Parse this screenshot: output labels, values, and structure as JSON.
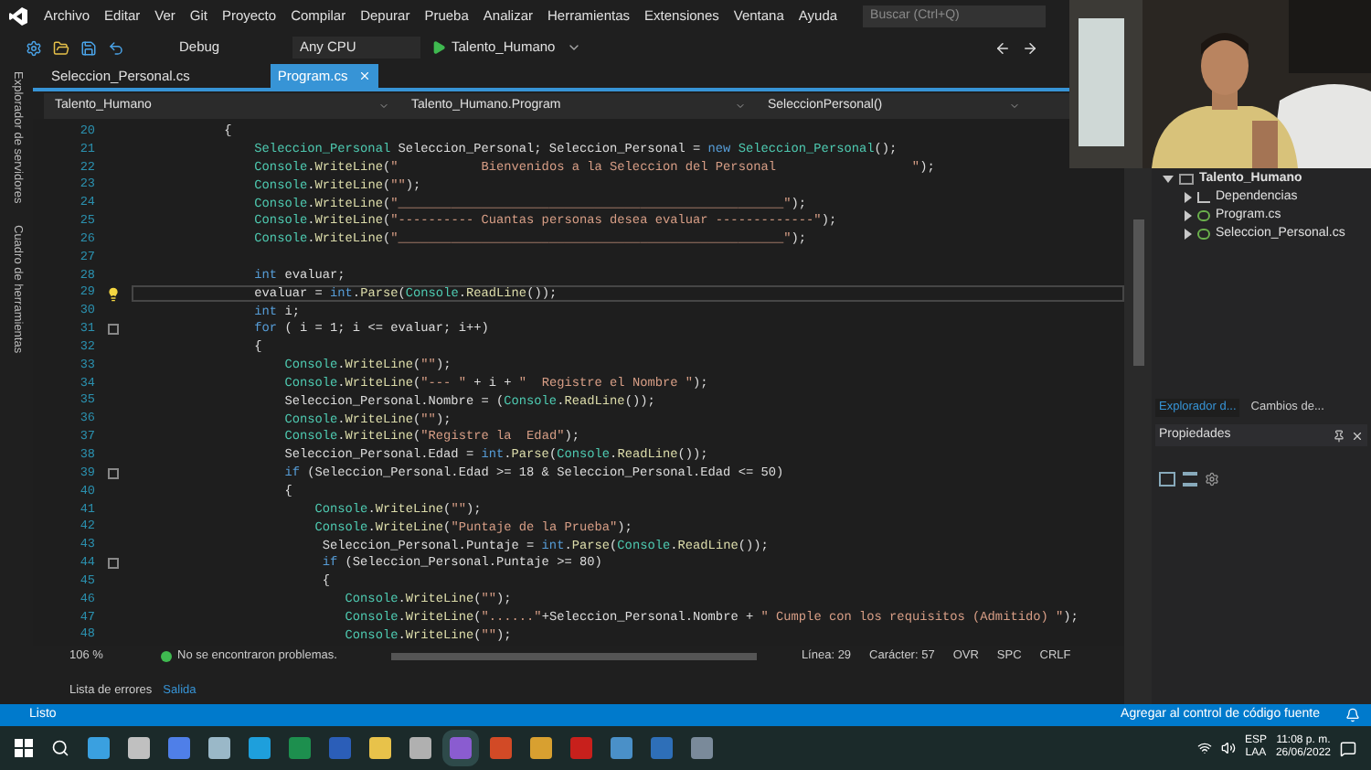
{
  "menu": [
    "Archivo",
    "Editar",
    "Ver",
    "Git",
    "Proyecto",
    "Compilar",
    "Depurar",
    "Prueba",
    "Analizar",
    "Herramientas",
    "Extensiones",
    "Ventana",
    "Ayuda"
  ],
  "search": {
    "placeholder": "Buscar (Ctrl+Q)"
  },
  "toolbar": {
    "configuration": "Debug",
    "platform": "Any CPU",
    "start_project": "Talento_Humano"
  },
  "side_tabs": [
    "Explorador de servidores",
    "Cuadro de herramientas"
  ],
  "doc_tabs": [
    {
      "label": "Seleccion_Personal.cs",
      "selected": false
    },
    {
      "label": "Program.cs",
      "selected": true
    }
  ],
  "nav_bar": [
    "Talento_Humano",
    "Talento_Humano.Program",
    "SeleccionPersonal()"
  ],
  "code_lines": [
    {
      "number": "20",
      "current": false,
      "tokens": [
        {
          "kind": "p",
          "text": "            {"
        }
      ]
    },
    {
      "number": "21",
      "current": false,
      "tokens": [
        {
          "kind": "type",
          "text": "                Seleccion_Personal"
        },
        {
          "kind": "p",
          "text": " Seleccion_Personal; Seleccion_Personal = "
        },
        {
          "kind": "kw",
          "text": "new"
        },
        {
          "kind": "type",
          "text": " Seleccion_Personal"
        },
        {
          "kind": "p",
          "text": "();"
        }
      ]
    },
    {
      "number": "22",
      "current": false,
      "tokens": [
        {
          "kind": "type",
          "text": "                Console"
        },
        {
          "kind": "p",
          "text": "."
        },
        {
          "kind": "fn",
          "text": "WriteLine"
        },
        {
          "kind": "p",
          "text": "("
        },
        {
          "kind": "str",
          "text": "\"           Bienvenidos a la Seleccion del Personal                  \""
        },
        {
          "kind": "p",
          "text": ");"
        }
      ]
    },
    {
      "number": "23",
      "current": false,
      "tokens": [
        {
          "kind": "type",
          "text": "                Console"
        },
        {
          "kind": "p",
          "text": "."
        },
        {
          "kind": "fn",
          "text": "WriteLine"
        },
        {
          "kind": "p",
          "text": "("
        },
        {
          "kind": "str",
          "text": "\"\""
        },
        {
          "kind": "p",
          "text": ");"
        }
      ]
    },
    {
      "number": "24",
      "current": false,
      "tokens": [
        {
          "kind": "type",
          "text": "                Console"
        },
        {
          "kind": "p",
          "text": "."
        },
        {
          "kind": "fn",
          "text": "WriteLine"
        },
        {
          "kind": "p",
          "text": "("
        },
        {
          "kind": "str",
          "text": "\"___________________________________________________\""
        },
        {
          "kind": "p",
          "text": ");"
        }
      ]
    },
    {
      "number": "25",
      "current": false,
      "tokens": [
        {
          "kind": "type",
          "text": "                Console"
        },
        {
          "kind": "p",
          "text": "."
        },
        {
          "kind": "fn",
          "text": "WriteLine"
        },
        {
          "kind": "p",
          "text": "("
        },
        {
          "kind": "str",
          "text": "\"---------- Cuantas personas desea evaluar -------------\""
        },
        {
          "kind": "p",
          "text": ");"
        }
      ]
    },
    {
      "number": "26",
      "current": false,
      "tokens": [
        {
          "kind": "type",
          "text": "                Console"
        },
        {
          "kind": "p",
          "text": "."
        },
        {
          "kind": "fn",
          "text": "WriteLine"
        },
        {
          "kind": "p",
          "text": "("
        },
        {
          "kind": "str",
          "text": "\"___________________________________________________\""
        },
        {
          "kind": "p",
          "text": ");"
        }
      ]
    },
    {
      "number": "27",
      "current": false
    },
    {
      "number": "28",
      "current": false,
      "tokens": [
        {
          "kind": "kw",
          "text": "                int"
        },
        {
          "kind": "p",
          "text": " evaluar;"
        }
      ]
    },
    {
      "number": "29",
      "current": true,
      "kind": "bulb",
      "tokens": [
        {
          "kind": "p",
          "text": "                evaluar = "
        },
        {
          "kind": "kw",
          "text": "int"
        },
        {
          "kind": "p",
          "text": "."
        },
        {
          "kind": "fn",
          "text": "Parse"
        },
        {
          "kind": "p",
          "text": "("
        },
        {
          "kind": "type",
          "text": "Console"
        },
        {
          "kind": "p",
          "text": "."
        },
        {
          "kind": "fn",
          "text": "ReadLine"
        },
        {
          "kind": "p",
          "text": "());"
        }
      ]
    },
    {
      "number": "30",
      "current": false,
      "tokens": [
        {
          "kind": "kw",
          "text": "                int"
        },
        {
          "kind": "p",
          "text": " i;"
        }
      ]
    },
    {
      "number": "31",
      "current": false,
      "kind": "fold",
      "tokens": [
        {
          "kind": "kw",
          "text": "                for"
        },
        {
          "kind": "p",
          "text": " ( i = 1; i <= evaluar; i++)"
        }
      ]
    },
    {
      "number": "32",
      "current": false,
      "tokens": [
        {
          "kind": "p",
          "text": "                {"
        }
      ]
    },
    {
      "number": "33",
      "current": false,
      "tokens": [
        {
          "kind": "type",
          "text": "                    Console"
        },
        {
          "kind": "p",
          "text": "."
        },
        {
          "kind": "fn",
          "text": "WriteLine"
        },
        {
          "kind": "p",
          "text": "("
        },
        {
          "kind": "str",
          "text": "\"\""
        },
        {
          "kind": "p",
          "text": ");"
        }
      ]
    },
    {
      "number": "34",
      "current": false,
      "tokens": [
        {
          "kind": "type",
          "text": "                    Console"
        },
        {
          "kind": "p",
          "text": "."
        },
        {
          "kind": "fn",
          "text": "WriteLine"
        },
        {
          "kind": "p",
          "text": "("
        },
        {
          "kind": "str",
          "text": "\"--- \""
        },
        {
          "kind": "p",
          "text": " + i + "
        },
        {
          "kind": "str",
          "text": "\"  Registre el Nombre \""
        },
        {
          "kind": "p",
          "text": ");"
        }
      ]
    },
    {
      "number": "35",
      "current": false,
      "tokens": [
        {
          "kind": "p",
          "text": "                    Seleccion_Personal.Nombre = ("
        },
        {
          "kind": "type",
          "text": "Console"
        },
        {
          "kind": "p",
          "text": "."
        },
        {
          "kind": "fn",
          "text": "ReadLine"
        },
        {
          "kind": "p",
          "text": "());"
        }
      ]
    },
    {
      "number": "36",
      "current": false,
      "tokens": [
        {
          "kind": "type",
          "text": "                    Console"
        },
        {
          "kind": "p",
          "text": "."
        },
        {
          "kind": "fn",
          "text": "WriteLine"
        },
        {
          "kind": "p",
          "text": "("
        },
        {
          "kind": "str",
          "text": "\"\""
        },
        {
          "kind": "p",
          "text": ");"
        }
      ]
    },
    {
      "number": "37",
      "current": false,
      "tokens": [
        {
          "kind": "type",
          "text": "                    Console"
        },
        {
          "kind": "p",
          "text": "."
        },
        {
          "kind": "fn",
          "text": "WriteLine"
        },
        {
          "kind": "p",
          "text": "("
        },
        {
          "kind": "str",
          "text": "\"Registre la  Edad\""
        },
        {
          "kind": "p",
          "text": ");"
        }
      ]
    },
    {
      "number": "38",
      "current": false,
      "tokens": [
        {
          "kind": "p",
          "text": "                    Seleccion_Personal.Edad = "
        },
        {
          "kind": "kw",
          "text": "int"
        },
        {
          "kind": "p",
          "text": "."
        },
        {
          "kind": "fn",
          "text": "Parse"
        },
        {
          "kind": "p",
          "text": "("
        },
        {
          "kind": "type",
          "text": "Console"
        },
        {
          "kind": "p",
          "text": "."
        },
        {
          "kind": "fn",
          "text": "ReadLine"
        },
        {
          "kind": "p",
          "text": "());"
        }
      ]
    },
    {
      "number": "39",
      "current": false,
      "kind": "fold",
      "tokens": [
        {
          "kind": "kw",
          "text": "                    if"
        },
        {
          "kind": "p",
          "text": " (Seleccion_Personal.Edad >= 18 & Seleccion_Personal.Edad <= 50)"
        }
      ]
    },
    {
      "number": "40",
      "current": false,
      "tokens": [
        {
          "kind": "p",
          "text": "                    {"
        }
      ]
    },
    {
      "number": "41",
      "current": false,
      "tokens": [
        {
          "kind": "type",
          "text": "                        Console"
        },
        {
          "kind": "p",
          "text": "."
        },
        {
          "kind": "fn",
          "text": "WriteLine"
        },
        {
          "kind": "p",
          "text": "("
        },
        {
          "kind": "str",
          "text": "\"\""
        },
        {
          "kind": "p",
          "text": ");"
        }
      ]
    },
    {
      "number": "42",
      "current": false,
      "tokens": [
        {
          "kind": "type",
          "text": "                        Console"
        },
        {
          "kind": "p",
          "text": "."
        },
        {
          "kind": "fn",
          "text": "WriteLine"
        },
        {
          "kind": "p",
          "text": "("
        },
        {
          "kind": "str",
          "text": "\"Puntaje de la Prueba\""
        },
        {
          "kind": "p",
          "text": ");"
        }
      ]
    },
    {
      "number": "43",
      "current": false,
      "tokens": [
        {
          "kind": "p",
          "text": "                         Seleccion_Personal.Puntaje = "
        },
        {
          "kind": "kw",
          "text": "int"
        },
        {
          "kind": "p",
          "text": "."
        },
        {
          "kind": "fn",
          "text": "Parse"
        },
        {
          "kind": "p",
          "text": "("
        },
        {
          "kind": "type",
          "text": "Console"
        },
        {
          "kind": "p",
          "text": "."
        },
        {
          "kind": "fn",
          "text": "ReadLine"
        },
        {
          "kind": "p",
          "text": "());"
        }
      ]
    },
    {
      "number": "44",
      "current": false,
      "kind": "fold",
      "tokens": [
        {
          "kind": "kw",
          "text": "                         if"
        },
        {
          "kind": "p",
          "text": " (Seleccion_Personal.Puntaje >= 80)"
        }
      ]
    },
    {
      "number": "45",
      "current": false,
      "tokens": [
        {
          "kind": "p",
          "text": "                         {"
        }
      ]
    },
    {
      "number": "46",
      "current": false,
      "tokens": [
        {
          "kind": "type",
          "text": "                            Console"
        },
        {
          "kind": "p",
          "text": "."
        },
        {
          "kind": "fn",
          "text": "WriteLine"
        },
        {
          "kind": "p",
          "text": "("
        },
        {
          "kind": "str",
          "text": "\"\""
        },
        {
          "kind": "p",
          "text": ");"
        }
      ]
    },
    {
      "number": "47",
      "current": false,
      "tokens": [
        {
          "kind": "type",
          "text": "                            Console"
        },
        {
          "kind": "p",
          "text": "."
        },
        {
          "kind": "fn",
          "text": "WriteLine"
        },
        {
          "kind": "p",
          "text": "("
        },
        {
          "kind": "str",
          "text": "\"......\""
        },
        {
          "kind": "p",
          "text": "+Seleccion_Personal.Nombre + "
        },
        {
          "kind": "str",
          "text": "\" Cumple con los requisitos (Admitido) \""
        },
        {
          "kind": "p",
          "text": ");"
        }
      ]
    },
    {
      "number": "48",
      "current": false,
      "tokens": [
        {
          "kind": "type",
          "text": "                            Console"
        },
        {
          "kind": "p",
          "text": "."
        },
        {
          "kind": "fn",
          "text": "WriteLine"
        },
        {
          "kind": "p",
          "text": "("
        },
        {
          "kind": "str",
          "text": "\"\""
        },
        {
          "kind": "p",
          "text": ");"
        }
      ]
    }
  ],
  "editor_status": {
    "zoom": "106 %",
    "issues": "No se encontraron problemas.",
    "line": "Línea: 29",
    "column": "Carácter: 57",
    "overwrite": "OVR",
    "whitespace": "SPC",
    "line_endings": "CRLF"
  },
  "output_tabs": [
    {
      "label": "Lista de errores",
      "selected": false
    },
    {
      "label": "Salida",
      "selected": true
    }
  ],
  "solution_tree": [
    {
      "label": "Talento_Humano",
      "kind": "project",
      "expanded": true,
      "children": [
        {
          "label": "Dependencias",
          "kind": "deps",
          "expanded": false
        },
        {
          "label": "Program.cs",
          "kind": "cs",
          "expanded": false
        },
        {
          "label": "Seleccion_Personal.cs",
          "kind": "cs",
          "expanded": false
        }
      ]
    }
  ],
  "explorer_tabs": [
    {
      "label": "Explorador d...",
      "selected": true
    },
    {
      "label": "Cambios de...",
      "selected": false
    }
  ],
  "properties": {
    "title": "Propiedades"
  },
  "status_bar": {
    "state": "Listo",
    "source_control": "Agregar al control de código fuente"
  },
  "webcam": {
    "kind": "picture"
  },
  "taskbar": {
    "apps": [
      {
        "color": "#3aa0e0",
        "selected": false
      },
      {
        "color": "#c0c0c0",
        "selected": false
      },
      {
        "color": "#4f7fe8",
        "selected": false
      },
      {
        "color": "#9ab8c8",
        "selected": false
      },
      {
        "color": "#1e9fdc",
        "selected": false
      },
      {
        "color": "#1d8f4e",
        "selected": false
      },
      {
        "color": "#2b5eb8",
        "selected": false
      },
      {
        "color": "#e8c24a",
        "selected": false
      },
      {
        "color": "#b0b0b0",
        "selected": false
      },
      {
        "color": "#8a5cd0",
        "selected": true
      },
      {
        "color": "#d24a26",
        "selected": false
      },
      {
        "color": "#d8a030",
        "selected": false
      },
      {
        "color": "#c8201c",
        "selected": false
      },
      {
        "color": "#4a90c8",
        "selected": false
      },
      {
        "color": "#2e6fb8",
        "selected": false
      },
      {
        "color": "#7a8a9a",
        "selected": false
      }
    ],
    "language": "ESP",
    "layout": "LAA",
    "time": "11:08 p. m.",
    "date": "26/06/2022"
  }
}
